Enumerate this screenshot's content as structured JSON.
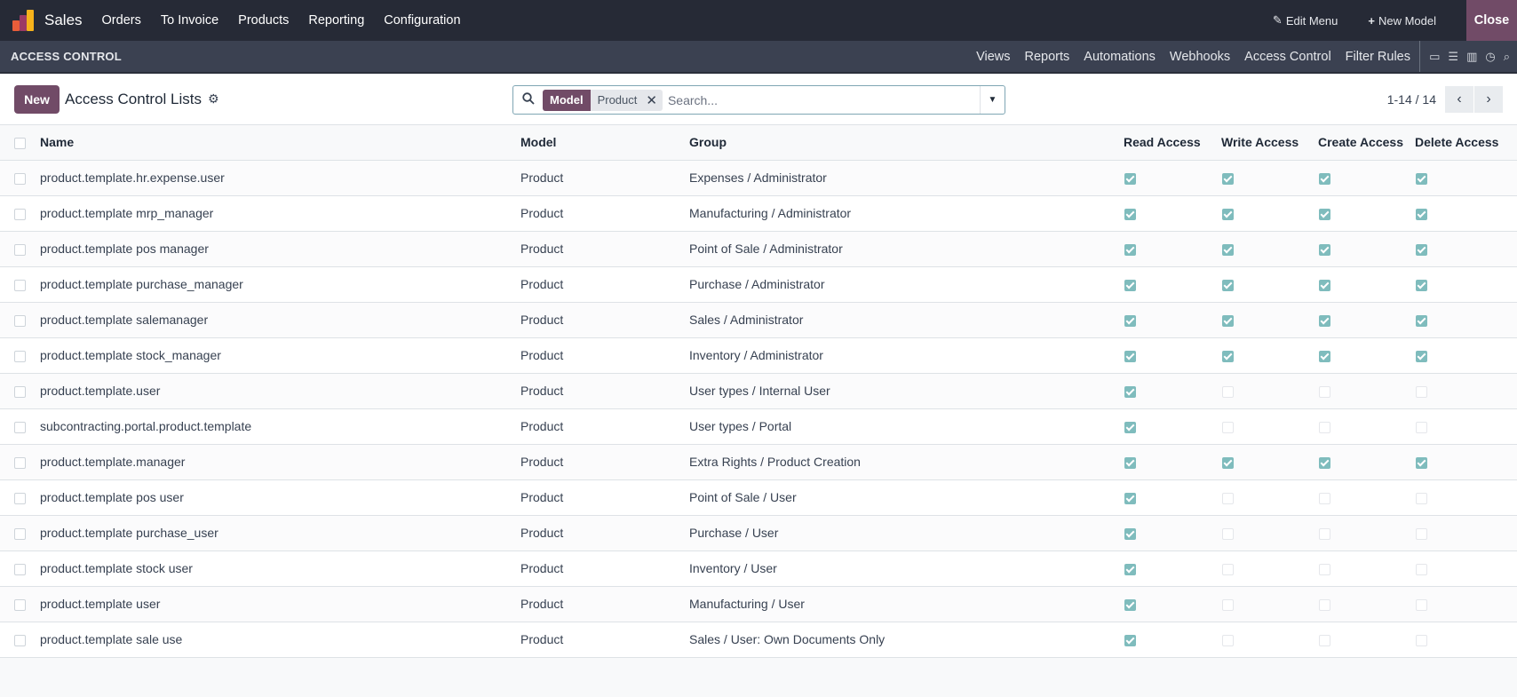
{
  "navbar": {
    "app_name": "Sales",
    "menu": [
      "Orders",
      "To Invoice",
      "Products",
      "Reporting",
      "Configuration"
    ],
    "edit_menu": "Edit Menu",
    "new_model": "New Model",
    "close": "Close"
  },
  "studio_bar": {
    "section": "ACCESS CONTROL",
    "tabs": [
      "Views",
      "Reports",
      "Automations",
      "Webhooks",
      "Access Control",
      "Filter Rules"
    ]
  },
  "control_panel": {
    "new_button": "New",
    "title": "Access Control Lists",
    "facet_key": "Model",
    "facet_value": "Product",
    "search_placeholder": "Search...",
    "pager": "1-14 / 14"
  },
  "table": {
    "columns": [
      "Name",
      "Model",
      "Group",
      "Read Access",
      "Write Access",
      "Create Access",
      "Delete Access"
    ],
    "rows": [
      {
        "name": "product.template.hr.expense.user",
        "model": "Product",
        "group": "Expenses / Administrator",
        "read": true,
        "write": true,
        "create": true,
        "delete": true
      },
      {
        "name": "product.template mrp_manager",
        "model": "Product",
        "group": "Manufacturing / Administrator",
        "read": true,
        "write": true,
        "create": true,
        "delete": true
      },
      {
        "name": "product.template pos manager",
        "model": "Product",
        "group": "Point of Sale / Administrator",
        "read": true,
        "write": true,
        "create": true,
        "delete": true
      },
      {
        "name": "product.template purchase_manager",
        "model": "Product",
        "group": "Purchase / Administrator",
        "read": true,
        "write": true,
        "create": true,
        "delete": true
      },
      {
        "name": "product.template salemanager",
        "model": "Product",
        "group": "Sales / Administrator",
        "read": true,
        "write": true,
        "create": true,
        "delete": true
      },
      {
        "name": "product.template stock_manager",
        "model": "Product",
        "group": "Inventory / Administrator",
        "read": true,
        "write": true,
        "create": true,
        "delete": true
      },
      {
        "name": "product.template.user",
        "model": "Product",
        "group": "User types / Internal User",
        "read": true,
        "write": false,
        "create": false,
        "delete": false
      },
      {
        "name": "subcontracting.portal.product.template",
        "model": "Product",
        "group": "User types / Portal",
        "read": true,
        "write": false,
        "create": false,
        "delete": false
      },
      {
        "name": "product.template.manager",
        "model": "Product",
        "group": "Extra Rights / Product Creation",
        "read": true,
        "write": true,
        "create": true,
        "delete": true
      },
      {
        "name": "product.template pos user",
        "model": "Product",
        "group": "Point of Sale / User",
        "read": true,
        "write": false,
        "create": false,
        "delete": false
      },
      {
        "name": "product.template purchase_user",
        "model": "Product",
        "group": "Purchase / User",
        "read": true,
        "write": false,
        "create": false,
        "delete": false
      },
      {
        "name": "product.template stock user",
        "model": "Product",
        "group": "Inventory / User",
        "read": true,
        "write": false,
        "create": false,
        "delete": false
      },
      {
        "name": "product.template user",
        "model": "Product",
        "group": "Manufacturing / User",
        "read": true,
        "write": false,
        "create": false,
        "delete": false
      },
      {
        "name": "product.template sale use",
        "model": "Product",
        "group": "Sales / User: Own Documents Only",
        "read": true,
        "write": false,
        "create": false,
        "delete": false
      }
    ]
  },
  "colors": {
    "brand": "#714b67",
    "navbar": "#262a36",
    "studio_bar": "#3b4151",
    "checkbox_on": "#7fbcbd"
  }
}
